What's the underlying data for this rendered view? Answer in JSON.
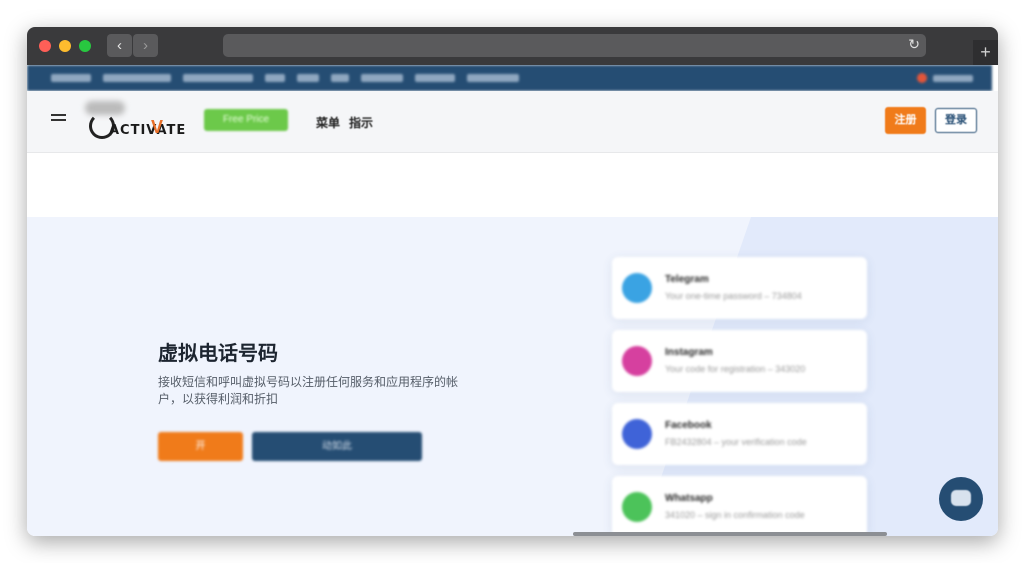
{
  "browser": {
    "back_icon": "chevron-left-icon",
    "forward_icon": "chevron-right-icon",
    "reload_icon": "reload-icon",
    "new_tab_icon": "plus-icon",
    "back_glyph": "‹",
    "forward_glyph": "›",
    "reload_glyph": "↻",
    "new_tab_glyph": "+"
  },
  "header": {
    "logo_text": "ACTIVATE",
    "logo_v": "V",
    "free_label": "Free Price",
    "nav": [
      "菜单",
      "指示"
    ],
    "register_label": "注册",
    "login_label": "登录"
  },
  "hero": {
    "title": "虚拟电话号码",
    "description": "接收短信和呼叫虚拟号码以注册任何服务和应用程序的帐户，以获得利润和折扣",
    "primary_label": "开",
    "secondary_label": "动如此"
  },
  "cards": [
    {
      "title": "Telegram",
      "subtitle": "Your one-time password – 734804",
      "color": "#3aa3e3"
    },
    {
      "title": "Instagram",
      "subtitle": "Your code for registration – 343020",
      "color": "#d6409f"
    },
    {
      "title": "Facebook",
      "subtitle": "FB2432804 – your verification code",
      "color": "#3f63d8"
    },
    {
      "title": "Whatsapp",
      "subtitle": "341020 – sign in confirmation code",
      "color": "#4cc35a"
    }
  ],
  "colors": {
    "brand_blue": "#254d73",
    "accent_orange": "#f07b1a",
    "free_green": "#6cc94a"
  }
}
